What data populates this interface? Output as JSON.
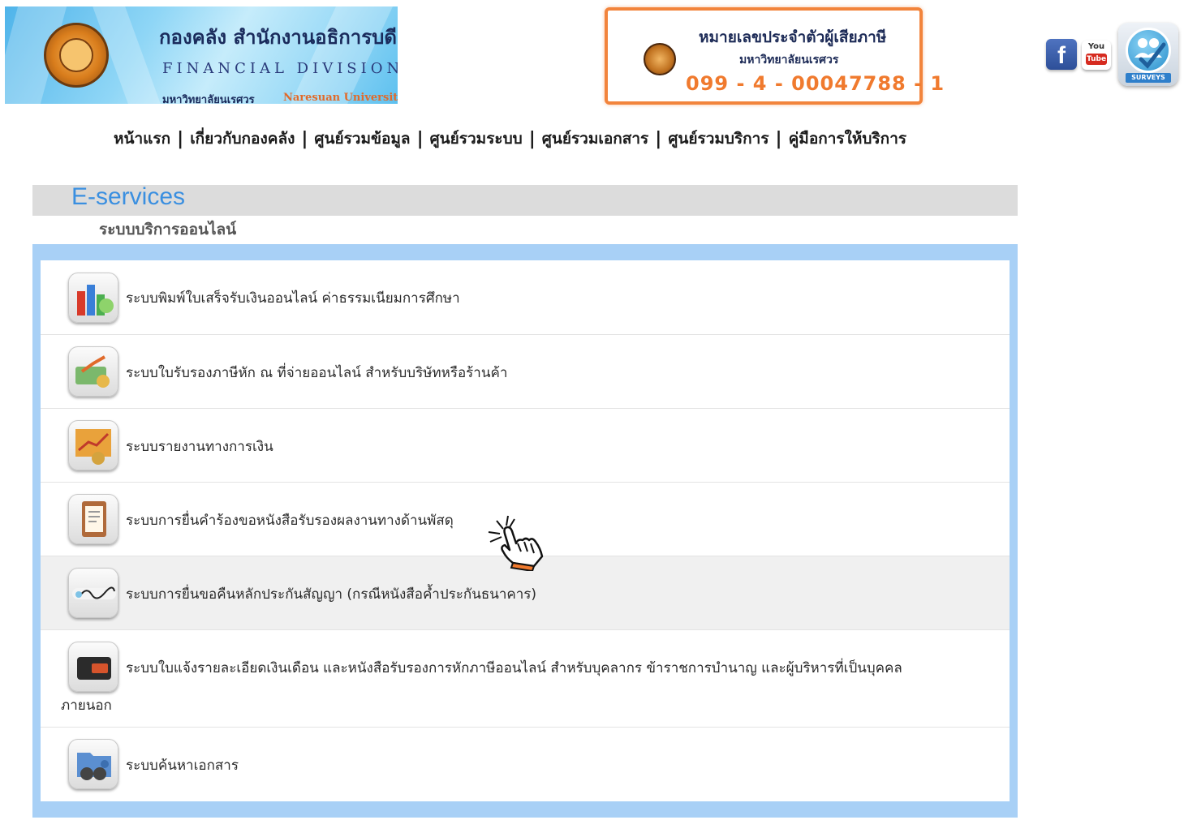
{
  "header": {
    "banner": {
      "title_th": "กองคลัง  สำนักงานอธิการบดี",
      "title_en": "FINANCIAL DIVISION",
      "university_th": "มหาวิทยาลัยนเรศวร",
      "university_en": "Naresuan University"
    },
    "taxpayer": {
      "title": "หมายเลขประจำตัวผู้เสียภาษี",
      "university": "มหาวิทยาลัยนเรศวร",
      "number": "099 - 4 - 00047788 - 1"
    },
    "social": {
      "facebook_glyph": "f",
      "youtube_you": "You",
      "youtube_tube": "Tube",
      "surveys_label": "SURVEYS"
    }
  },
  "nav": {
    "items": [
      "หน้าแรก",
      "เกี่ยวกับกองคลัง",
      "ศูนย์รวมข้อมูล",
      "ศูนย์รวมระบบ",
      "ศูนย์รวมเอกสาร",
      "ศูนย์รวมบริการ",
      "คู่มือการให้บริการ"
    ],
    "separator": "|"
  },
  "eservices": {
    "title": "E-services",
    "subtitle": "ระบบบริการออนไลน์",
    "items": [
      {
        "label": "ระบบพิมพ์ใบเสร็จรับเงินออนไลน์ ค่าธรรมเนียมการศึกษา",
        "icon": "receipt-chart-icon"
      },
      {
        "label": "ระบบใบรับรองภาษีหัก ณ ที่จ่ายออนไลน์ สำหรับบริษัทหรือร้านค้า",
        "icon": "money-growth-icon"
      },
      {
        "label": "ระบบรายงานทางการเงิน",
        "icon": "finance-report-icon"
      },
      {
        "label": "ระบบการยื่นคำร้องขอหนังสือรับรองผลงานทางด้านพัสดุ",
        "icon": "clipboard-icon"
      },
      {
        "label": "ระบบการยื่นขอคืนหลักประกันสัญญา (กรณีหนังสือค้ำประกันธนาคาร)",
        "icon": "signature-icon"
      },
      {
        "label": "ระบบใบแจ้งรายละเอียดเงินเดือน และหนังสือรับรองการหักภาษีออนไลน์ สำหรับบุคลากร ข้าราชการบำนาญ และผู้บริหารที่เป็นบุคคล",
        "label_wrap": "ภายนอก",
        "icon": "wallet-icon"
      },
      {
        "label": "ระบบค้นหาเอกสาร",
        "icon": "folder-search-icon"
      }
    ]
  },
  "colors": {
    "accent": "#3a8fe0",
    "panel_border": "#a8d0f6",
    "taxbox_border": "#f2843c",
    "taxnum": "#f07a2e"
  }
}
